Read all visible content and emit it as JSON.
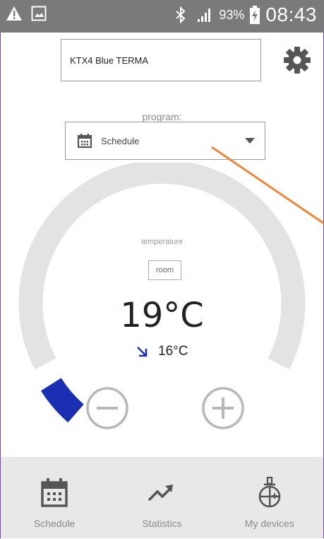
{
  "status_bar": {
    "battery_percent": "93%",
    "time": "08:43",
    "icons": [
      "warning-icon",
      "image-icon",
      "bluetooth-icon",
      "signal-icon",
      "battery-charging-icon"
    ]
  },
  "header": {
    "device_name": "KTX4 Blue TERMA",
    "settings_icon": "gear-icon"
  },
  "program": {
    "label": "program:",
    "selected": "Schedule",
    "icon": "calendar-icon"
  },
  "thermostat": {
    "label": "temperature",
    "mode_badge": "room",
    "current_temp": "19°C",
    "target_temp": "16°C",
    "trend_icon": "arrow-down-right-icon",
    "gauge_fill_fraction": 0.06,
    "colors": {
      "track": "#e3e3e3",
      "fill": "#1b2fb3",
      "accent": "#1b2fb3"
    }
  },
  "controls": {
    "minus_icon": "minus-circle-icon",
    "plus_icon": "plus-circle-icon"
  },
  "bottom_nav": {
    "items": [
      {
        "label": "Schedule",
        "icon": "calendar-icon"
      },
      {
        "label": "Statistics",
        "icon": "trend-up-icon"
      },
      {
        "label": "My devices",
        "icon": "thermometer-device-icon"
      }
    ]
  },
  "annotation_color": "#f0863a"
}
